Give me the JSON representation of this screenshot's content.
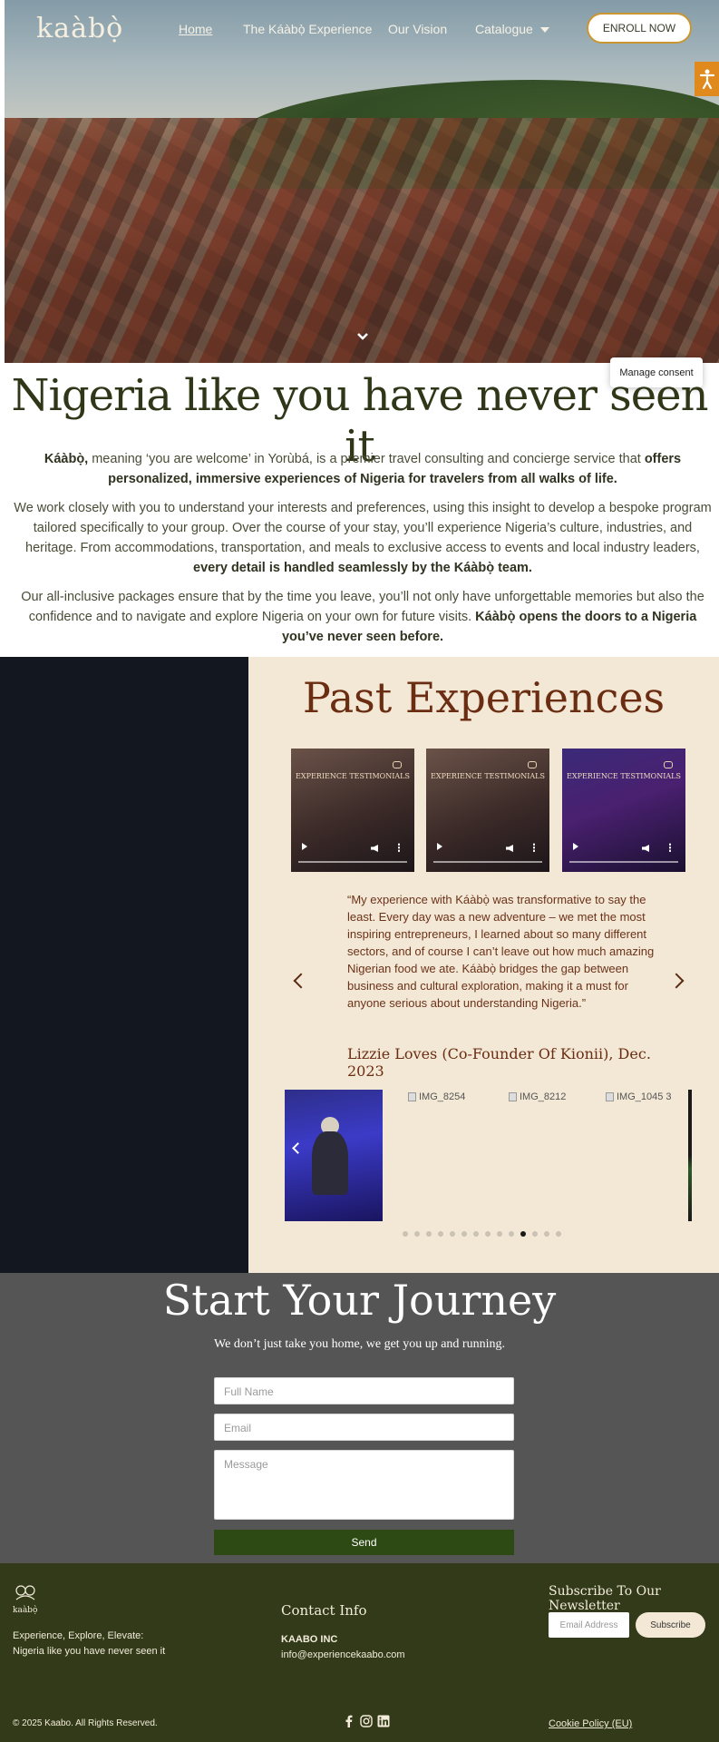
{
  "nav": {
    "logo": "kaàbọ̀",
    "links": [
      {
        "label": "Home"
      },
      {
        "label": "The Káàbọ̀ Experience"
      },
      {
        "label": "Our Vision"
      },
      {
        "label": "Catalogue"
      }
    ],
    "enroll_label": "ENROLL NOW"
  },
  "consent": {
    "label": "Manage consent"
  },
  "intro": {
    "title": "Nigeria like you have never seen it",
    "p1_a": "Káàbọ̀,",
    "p1_b": " meaning ‘you are welcome’ in Yorùbá, is a premier travel consulting and concierge service that ",
    "p1_c": "offers personalized, immersive experiences of Nigeria for travelers from all walks of life.",
    "p2_a": "We work closely with you to understand your interests and preferences, using this insight to develop a bespoke program tailored specifically to your group. Over the course of your stay, you’ll experience Nigeria’s culture, industries, and heritage. From accommodations, transportation, and meals to exclusive access to events and local industry leaders, ",
    "p2_b": "every detail is handled seamlessly by the Káàbọ̀ team.",
    "p3_a": "Our all-inclusive packages ensure that by the time you leave, you’ll not only have unforgettable memories but also the confidence and to navigate and explore Nigeria on your own for future visits. ",
    "p3_b": "Káàbọ̀ opens the doors to a Nigeria you’ve never seen before."
  },
  "past": {
    "title": "Past Experiences",
    "video_titles": [
      "EXPERIENCE TESTIMONIALS",
      "EXPERIENCE TESTIMONIALS",
      "EXPERIENCE TESTIMONIALS"
    ],
    "quote": "“My experience with Káàbọ̀ was transformative to say the least. Every day was a new adventure – we met the most inspiring entrepreneurs, I learned about so many different sectors, and of course I can’t leave out how much amazing Nigerian food we ate. Káàbọ̀ bridges the gap between business and cultural exploration, making it a must for anyone serious about understanding Nigeria.”",
    "author": "Lizzie Loves (Co-Founder Of Kionii), Dec. 2023",
    "gallery_alts": [
      "IMG_8254",
      "IMG_8212",
      "IMG_1045 3"
    ],
    "dot_count": 14,
    "active_dot": 10
  },
  "journey": {
    "title": "Start Your Journey",
    "subtitle": "We don’t just take you home, we get you up and running.",
    "full_name_placeholder": "Full Name",
    "email_placeholder": "Email",
    "message_placeholder": "Message",
    "send_label": "Send"
  },
  "footer": {
    "logo_text": "kaàbọ̀",
    "tagline_1": "Experience, Explore, Elevate:",
    "tagline_2": "Nigeria like you have never seen it",
    "contact_heading": "Contact Info",
    "company": "KAABO INC",
    "email": "info@experiencekaabo.com",
    "newsletter_heading": "Subscribe To Our Newsletter",
    "email_placeholder": "Email Address",
    "subscribe_label": "Subscribe",
    "copyright": "© 2025 Kaabo. All Rights Reserved.",
    "cookie_label": "Cookie Policy (EU)"
  },
  "colors": {
    "accent_gold": "#c9962f",
    "cream": "#f3e8d6",
    "dark": "#13171f",
    "olive": "#323a1a",
    "brown": "#6b2d12",
    "send_green": "#2e4a14"
  }
}
